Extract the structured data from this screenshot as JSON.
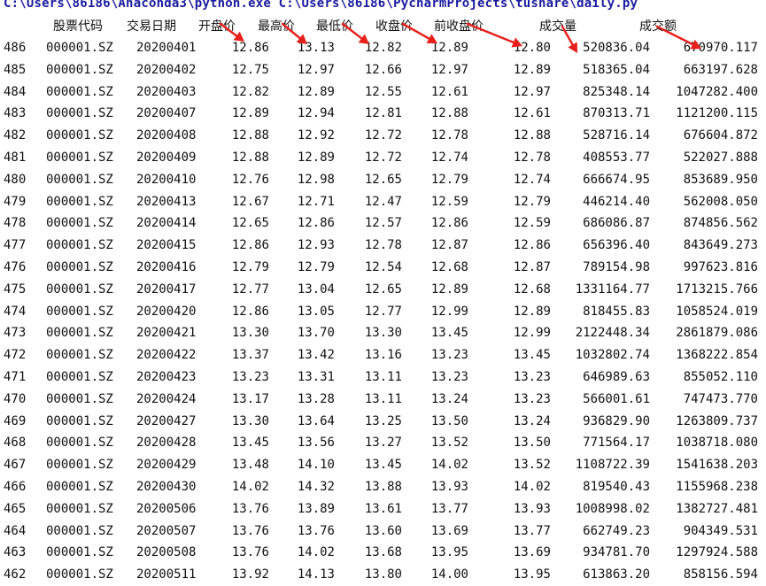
{
  "console": {
    "command_line": "C:\\Users\\86186\\Anaconda3\\python.exe C:\\Users\\86186\\PycharmProjects\\tushare\\daily.py"
  },
  "table": {
    "headers": [
      "股票代码",
      "交易日期",
      "开盘价",
      "最高价",
      "最低价",
      "收盘价",
      "前收盘价",
      "成交量",
      "成交额"
    ],
    "rows": [
      [
        "486",
        "000001.SZ",
        "20200401",
        "12.86",
        "13.13",
        "12.82",
        "12.89",
        "12.80",
        "520836.04",
        "670970.117"
      ],
      [
        "485",
        "000001.SZ",
        "20200402",
        "12.75",
        "12.97",
        "12.66",
        "12.97",
        "12.89",
        "518365.04",
        "663197.628"
      ],
      [
        "484",
        "000001.SZ",
        "20200403",
        "12.82",
        "12.89",
        "12.55",
        "12.61",
        "12.97",
        "825348.14",
        "1047282.400"
      ],
      [
        "483",
        "000001.SZ",
        "20200407",
        "12.89",
        "12.94",
        "12.81",
        "12.88",
        "12.61",
        "870313.71",
        "1121200.115"
      ],
      [
        "482",
        "000001.SZ",
        "20200408",
        "12.88",
        "12.92",
        "12.72",
        "12.78",
        "12.88",
        "528716.14",
        "676604.872"
      ],
      [
        "481",
        "000001.SZ",
        "20200409",
        "12.88",
        "12.89",
        "12.72",
        "12.74",
        "12.78",
        "408553.77",
        "522027.888"
      ],
      [
        "480",
        "000001.SZ",
        "20200410",
        "12.76",
        "12.98",
        "12.65",
        "12.79",
        "12.74",
        "666674.95",
        "853689.950"
      ],
      [
        "479",
        "000001.SZ",
        "20200413",
        "12.67",
        "12.71",
        "12.47",
        "12.59",
        "12.79",
        "446214.40",
        "562008.050"
      ],
      [
        "478",
        "000001.SZ",
        "20200414",
        "12.65",
        "12.86",
        "12.57",
        "12.86",
        "12.59",
        "686086.87",
        "874856.562"
      ],
      [
        "477",
        "000001.SZ",
        "20200415",
        "12.86",
        "12.93",
        "12.78",
        "12.87",
        "12.86",
        "656396.40",
        "843649.273"
      ],
      [
        "476",
        "000001.SZ",
        "20200416",
        "12.79",
        "12.79",
        "12.54",
        "12.68",
        "12.87",
        "789154.98",
        "997623.816"
      ],
      [
        "475",
        "000001.SZ",
        "20200417",
        "12.77",
        "13.04",
        "12.65",
        "12.89",
        "12.68",
        "1331164.77",
        "1713215.766"
      ],
      [
        "474",
        "000001.SZ",
        "20200420",
        "12.86",
        "13.05",
        "12.77",
        "12.99",
        "12.89",
        "818455.83",
        "1058524.019"
      ],
      [
        "473",
        "000001.SZ",
        "20200421",
        "13.30",
        "13.70",
        "13.30",
        "13.45",
        "12.99",
        "2122448.34",
        "2861879.086"
      ],
      [
        "472",
        "000001.SZ",
        "20200422",
        "13.37",
        "13.42",
        "13.16",
        "13.23",
        "13.45",
        "1032802.74",
        "1368222.854"
      ],
      [
        "471",
        "000001.SZ",
        "20200423",
        "13.23",
        "13.31",
        "13.11",
        "13.23",
        "13.23",
        "646989.63",
        "855052.110"
      ],
      [
        "470",
        "000001.SZ",
        "20200424",
        "13.17",
        "13.28",
        "13.11",
        "13.24",
        "13.23",
        "566001.61",
        "747473.770"
      ],
      [
        "469",
        "000001.SZ",
        "20200427",
        "13.30",
        "13.64",
        "13.25",
        "13.50",
        "13.24",
        "936829.90",
        "1263809.737"
      ],
      [
        "468",
        "000001.SZ",
        "20200428",
        "13.45",
        "13.56",
        "13.27",
        "13.52",
        "13.50",
        "771564.17",
        "1038718.080"
      ],
      [
        "467",
        "000001.SZ",
        "20200429",
        "13.48",
        "14.10",
        "13.45",
        "14.02",
        "13.52",
        "1108722.39",
        "1541638.203"
      ],
      [
        "466",
        "000001.SZ",
        "20200430",
        "14.02",
        "14.32",
        "13.88",
        "13.93",
        "14.02",
        "819540.43",
        "1155968.238"
      ],
      [
        "465",
        "000001.SZ",
        "20200506",
        "13.76",
        "13.89",
        "13.61",
        "13.77",
        "13.93",
        "1008998.02",
        "1382727.481"
      ],
      [
        "464",
        "000001.SZ",
        "20200507",
        "13.76",
        "13.76",
        "13.60",
        "13.69",
        "13.77",
        "662749.23",
        "904349.531"
      ],
      [
        "463",
        "000001.SZ",
        "20200508",
        "13.76",
        "14.02",
        "13.68",
        "13.95",
        "13.69",
        "934781.70",
        "1297924.588"
      ],
      [
        "462",
        "000001.SZ",
        "20200511",
        "13.92",
        "14.13",
        "13.80",
        "14.00",
        "13.95",
        "613863.20",
        "858156.594"
      ]
    ]
  },
  "colors": {
    "command_text": "#1a1aa0",
    "annotation_arrow": "#e8201c"
  },
  "annotation": {
    "arrow_icon": "red-arrow-icon"
  }
}
